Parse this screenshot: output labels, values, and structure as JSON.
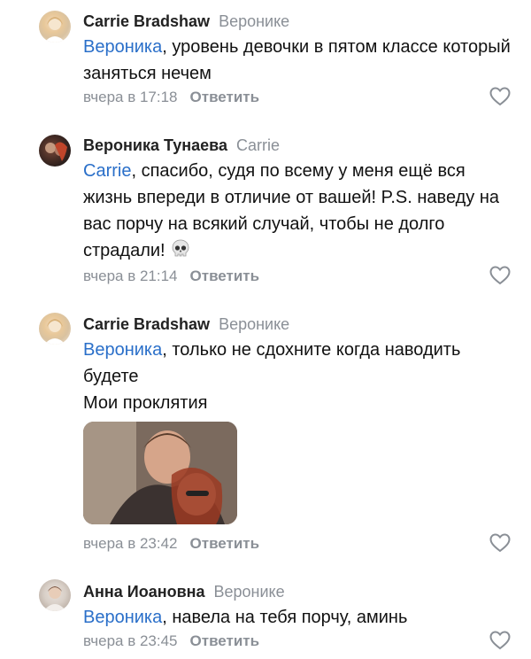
{
  "comments": [
    {
      "author": "Carrie Bradshaw",
      "reply_to": "Веронике",
      "mention": "Вероника",
      "text": ", уровень девочки в пятом классе который заняться нечем",
      "time": "вчера в 17:18",
      "reply_label": "Ответить",
      "avatar_icon": "avatar-photo"
    },
    {
      "author": "Вероника Тунаева",
      "reply_to": "Carrie",
      "mention": "Carrie",
      "text": ", спасибо, судя по всему у меня ещё вся жизнь впереди в отличие от вашей! P.S. наведу на вас порчу на всякий случай, чтобы не долго страдали!",
      "emoji_icon": "skull-emoji",
      "time": "вчера в 21:14",
      "reply_label": "Ответить",
      "avatar_icon": "avatar-photo"
    },
    {
      "author": "Carrie Bradshaw",
      "reply_to": "Веронике",
      "mention": "Вероника",
      "text": ", только не сдохните когда наводить будете",
      "text_line2": "Мои проклятия",
      "attachment": "photo-attachment",
      "time": "вчера в 23:42",
      "reply_label": "Ответить",
      "avatar_icon": "avatar-photo"
    },
    {
      "author": "Анна Иоановна",
      "reply_to": "Веронике",
      "mention": "Вероника",
      "text": ", навела на тебя порчу, аминь",
      "time": "вчера в 23:45",
      "reply_label": "Ответить",
      "avatar_icon": "avatar-photo"
    }
  ],
  "colors": {
    "mention": "#2a6fc9",
    "meta": "#8a8f96",
    "author": "#222222"
  }
}
